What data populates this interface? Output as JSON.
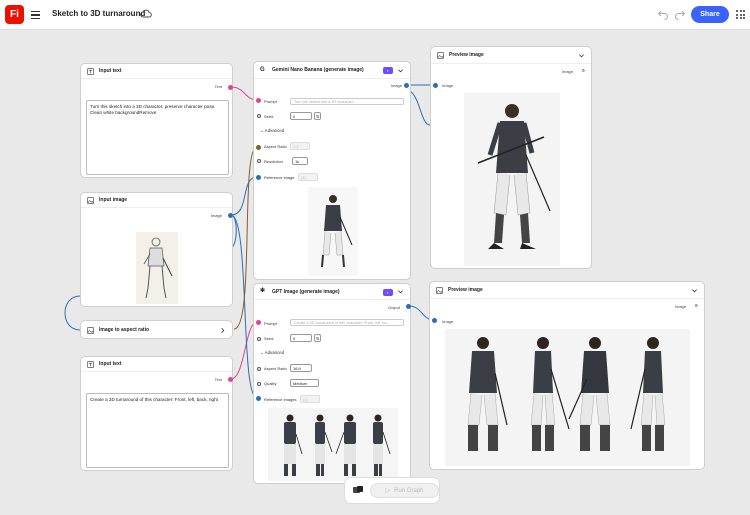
{
  "app": {
    "logo_text": "Fi",
    "document_title": "Sketch to 3D turnaround",
    "share_label": "Share"
  },
  "nodes": {
    "input_text_1": {
      "title": "Input text",
      "output_label": "Text",
      "value": "Turn this sketch into a 3D character, preserve character pose. Clean white backgroundRemove"
    },
    "input_image": {
      "title": "Input image",
      "output_label": "Image"
    },
    "aspect_ratio": {
      "title": "Image to aspect ratio"
    },
    "input_text_2": {
      "title": "Input text",
      "output_label": "Text",
      "value": "Create a 3D turnaround of this character: Front, left, back, right"
    },
    "gemini": {
      "title": "Gemini Nano Banana (generate image)",
      "output_label": "Image",
      "prompt_label": "Prompt",
      "prompt_placeholder": "Turn the sketch into a 3D character...",
      "seed_label": "Seed",
      "seed_value": "0",
      "advanced_label": "Advanced",
      "aspect_label": "Aspect Ratio",
      "aspect_value": "1:1",
      "resolution_label": "Resolution",
      "resolution_value": "1k",
      "reference_label": "Reference image",
      "reference_value": "(1)"
    },
    "gpt": {
      "title": "GPT Image (generate image)",
      "output_label": "Output",
      "prompt_label": "Prompt",
      "prompt_placeholder": "Create a 3D turnaround of this character: Front, left, ba...",
      "seed_label": "Seed",
      "seed_value": "0",
      "advanced_label": "Advanced",
      "aspect_label": "Aspect Ratio",
      "aspect_value": "16:9",
      "quality_label": "Quality",
      "quality_value": "Medium",
      "reference_label": "Reference images",
      "reference_value": "(1)"
    },
    "preview_1": {
      "title": "Preview image",
      "output_label": "Image",
      "input_label": "Image"
    },
    "preview_2": {
      "title": "Preview image",
      "output_label": "Image",
      "input_label": "Image"
    }
  },
  "run_label": "Run Graph",
  "colors": {
    "accent": "#3b63fb",
    "logo": "#eb1000",
    "text_port": "#e0458f",
    "image_port": "#2a6fb5",
    "badge": "#6d4cff"
  }
}
